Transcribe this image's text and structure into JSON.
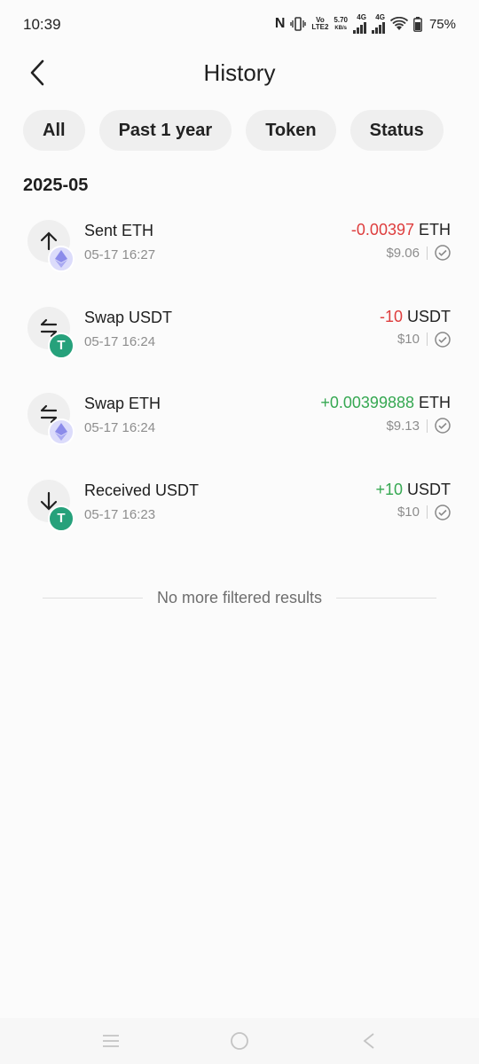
{
  "status_bar": {
    "time": "10:39",
    "volte": "Vo",
    "lte": "LTE2",
    "speed": "5.70",
    "speed_unit": "KB/s",
    "net1": "4G",
    "net2": "4G",
    "battery": "75%"
  },
  "header": {
    "title": "History"
  },
  "filters": [
    "All",
    "Past 1 year",
    "Token",
    "Status"
  ],
  "section": {
    "month": "2025-05"
  },
  "transactions": [
    {
      "title": "Sent ETH",
      "time": "05-17 16:27",
      "amount": "-0.00397",
      "unit": "ETH",
      "fiat": "$9.06",
      "direction": "sent",
      "token": "eth"
    },
    {
      "title": "Swap USDT",
      "time": "05-17 16:24",
      "amount": "-10",
      "unit": "USDT",
      "fiat": "$10",
      "direction": "swap",
      "token": "usdt"
    },
    {
      "title": "Swap ETH",
      "time": "05-17 16:24",
      "amount": "+0.00399888",
      "unit": "ETH",
      "fiat": "$9.13",
      "direction": "swap",
      "token": "eth"
    },
    {
      "title": "Received USDT",
      "time": "05-17 16:23",
      "amount": "+10",
      "unit": "USDT",
      "fiat": "$10",
      "direction": "received",
      "token": "usdt"
    }
  ],
  "footer": {
    "end_text": "No more filtered results"
  },
  "colors": {
    "negative": "#de3d3d",
    "positive": "#36a852",
    "usdt": "#26a17b"
  }
}
